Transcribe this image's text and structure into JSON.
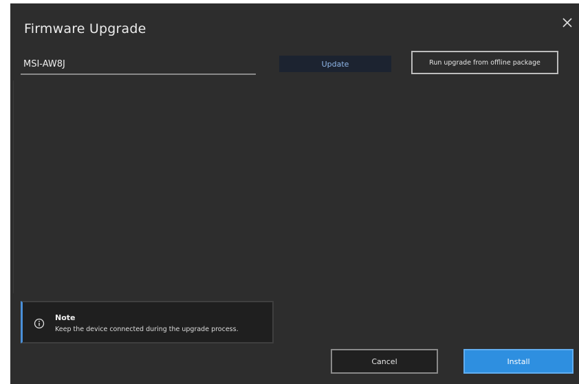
{
  "dialog": {
    "title": "Firmware Upgrade",
    "close_icon": "close-icon"
  },
  "device": {
    "model_value": "MSI-AW8J",
    "model_placeholder": ""
  },
  "toolbar": {
    "update_label": "Update",
    "offline_label": "Run upgrade from offline package"
  },
  "info": {
    "icon": "info-icon",
    "title": "Note",
    "message": "Keep the device connected during the upgrade process."
  },
  "footer": {
    "cancel_label": "Cancel",
    "install_label": "Install"
  },
  "colors": {
    "dialog_bg": "#2d2d2d",
    "accent": "#2e8fe0",
    "info_border": "#4a90d9"
  }
}
